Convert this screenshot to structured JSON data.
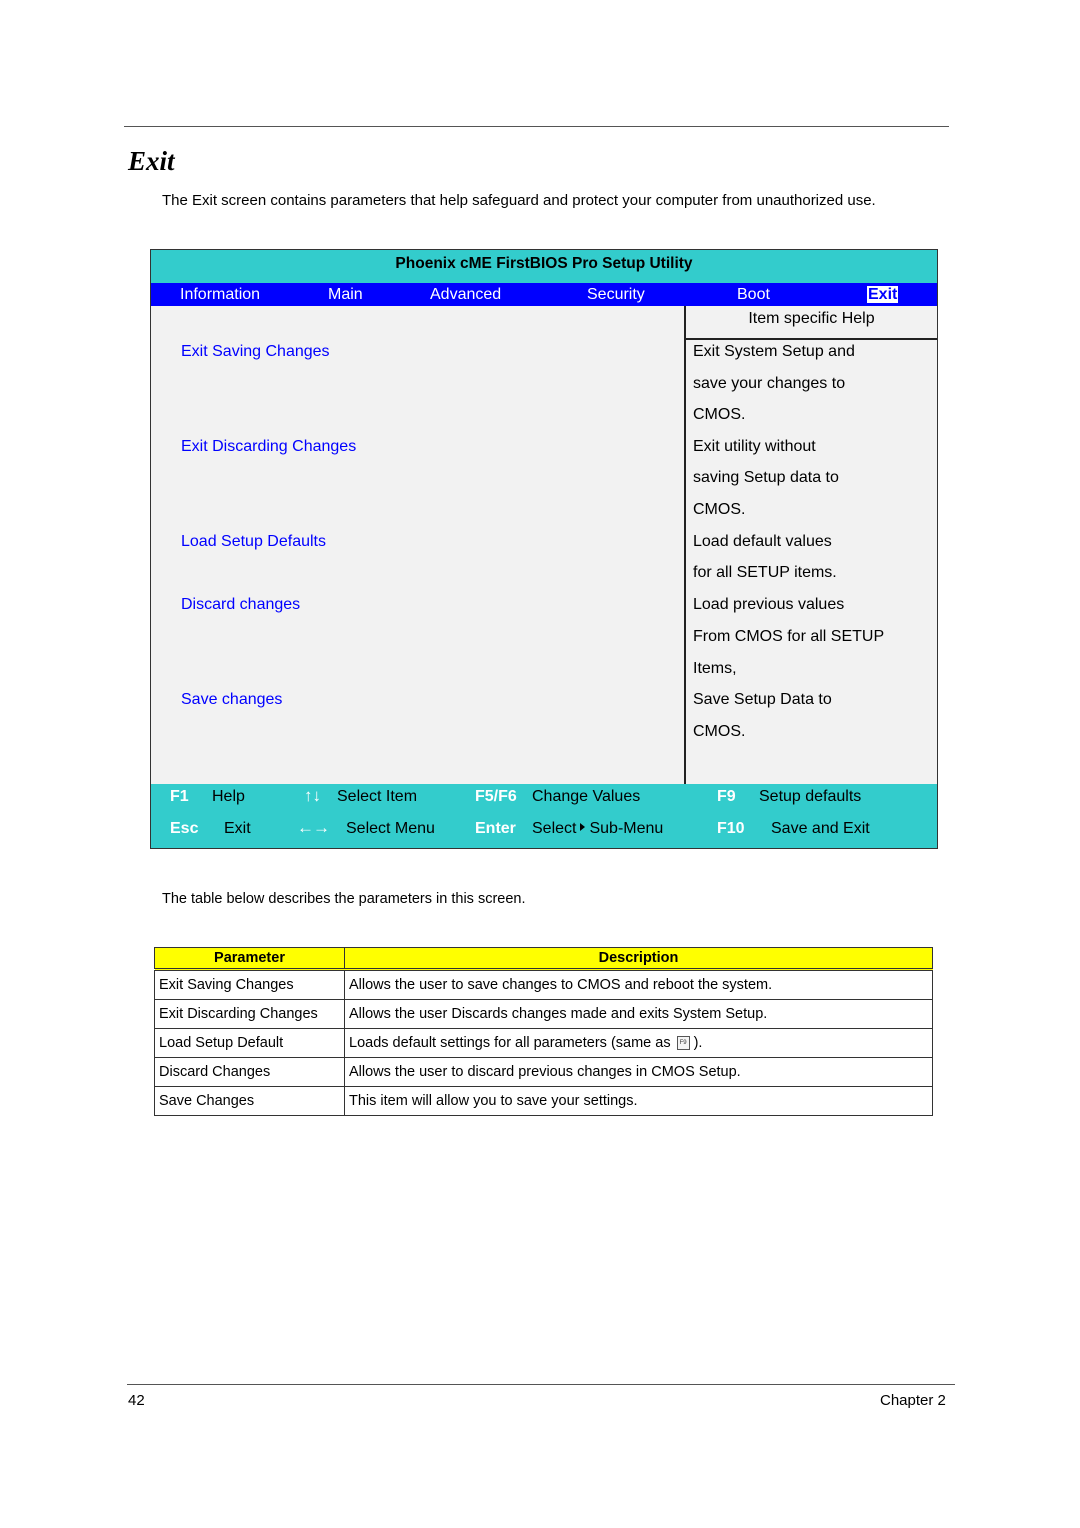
{
  "page": {
    "title": "Exit",
    "intro": "The Exit screen contains parameters that help safeguard and protect your computer from unauthorized use.",
    "after_text": "The table below describes the parameters in this screen.",
    "footer": {
      "page_number": "42",
      "chapter": "Chapter 2"
    }
  },
  "bios": {
    "title": "Phoenix cME FirstBIOS Pro Setup Utility",
    "tabs": [
      {
        "label": "Information",
        "active": false
      },
      {
        "label": "Main",
        "active": false
      },
      {
        "label": "Advanced",
        "active": false
      },
      {
        "label": "Security",
        "active": false
      },
      {
        "label": "Boot",
        "active": false
      },
      {
        "label": "Exit",
        "active": true
      }
    ],
    "colors": {
      "title_bar": "#33cccc",
      "menu_bar": "#0000ff",
      "option_text": "#0000ff",
      "panel": "#f2f2f2"
    },
    "help_header": "Item specific Help",
    "options": [
      "Exit Saving Changes",
      "Exit Discarding Changes",
      "Load Setup Defaults",
      "Discard changes",
      "Save changes"
    ],
    "help_lines": [
      "Exit System Setup and",
      "save your changes to",
      "CMOS.",
      "Exit utility without",
      "saving Setup data to",
      "CMOS.",
      "Load default values",
      "for all SETUP items.",
      "Load previous values",
      "From CMOS for all SETUP",
      "Items,",
      "Save Setup Data to",
      "CMOS."
    ],
    "keys": {
      "row1": [
        {
          "key": "F1",
          "action": "Help"
        },
        {
          "key": "↑↓",
          "action": "Select Item"
        },
        {
          "key": "F5/F6",
          "action": "Change Values"
        },
        {
          "key": "F9",
          "action": "Setup defaults"
        }
      ],
      "row2": [
        {
          "key": "Esc",
          "action": "Exit"
        },
        {
          "key": "←→",
          "action": "Select Menu"
        },
        {
          "key": "Enter",
          "action": "Select",
          "action2": "Sub-Menu"
        },
        {
          "key": "F10",
          "action": "Save and Exit"
        }
      ]
    }
  },
  "params_table": {
    "headers": [
      "Parameter",
      "Description"
    ],
    "header_color": "#ffff00",
    "rows": [
      {
        "parameter": "Exit Saving Changes",
        "description": "Allows the user to save changes to CMOS and reboot the system."
      },
      {
        "parameter": "Exit Discarding Changes",
        "description": "Allows the user Discards changes made and exits System Setup."
      },
      {
        "parameter": "Load Setup Default",
        "description": "Loads default settings for all parameters (same as",
        "description_icon": "F9",
        "description_suffix": ")."
      },
      {
        "parameter": "Discard Changes",
        "description": "Allows the user to discard previous changes in CMOS Setup."
      },
      {
        "parameter": "Save Changes",
        "description": "This item will allow you to save your settings."
      }
    ]
  }
}
